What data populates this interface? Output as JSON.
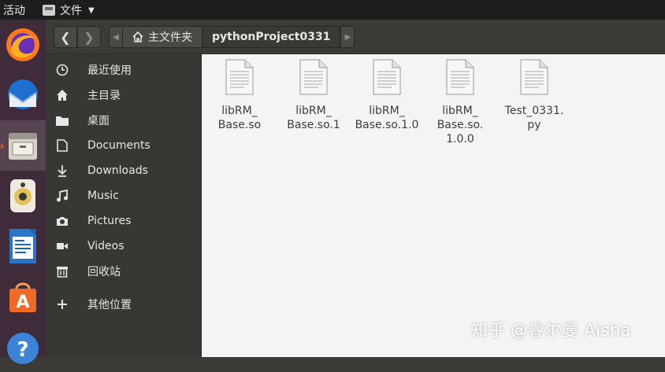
{
  "topbar": {
    "activities": "活动",
    "app_menu_label": "文件",
    "app_menu_icon": "file-manager-icon",
    "caret_icon": "caret-down-icon"
  },
  "dock": {
    "items": [
      {
        "name": "firefox",
        "icon": "firefox-icon"
      },
      {
        "name": "thunderbird",
        "icon": "thunderbird-icon"
      },
      {
        "name": "files",
        "icon": "file-cabinet-icon",
        "active": true
      },
      {
        "name": "rhythmbox",
        "icon": "speaker-icon"
      },
      {
        "name": "libreoffice-writer",
        "icon": "writer-icon"
      },
      {
        "name": "software",
        "icon": "software-bag-icon"
      },
      {
        "name": "help",
        "icon": "help-icon"
      }
    ]
  },
  "header": {
    "back_icon": "chevron-left-icon",
    "forward_icon": "chevron-right-icon",
    "home_icon": "home-icon",
    "breadcrumbs": [
      "主文件夹",
      "pythonProject0331"
    ]
  },
  "sidebar": {
    "items": [
      {
        "label": "最近使用",
        "icon": "recent-clock-icon"
      },
      {
        "label": "主目录",
        "icon": "home-icon"
      },
      {
        "label": "桌面",
        "icon": "folder-icon"
      },
      {
        "label": "Documents",
        "icon": "document-icon"
      },
      {
        "label": "Downloads",
        "icon": "download-arrow-icon"
      },
      {
        "label": "Music",
        "icon": "music-note-icon"
      },
      {
        "label": "Pictures",
        "icon": "camera-icon"
      },
      {
        "label": "Videos",
        "icon": "video-icon"
      },
      {
        "label": "回收站",
        "icon": "trash-icon"
      },
      {
        "label": "其他位置",
        "icon": "plus-icon"
      }
    ]
  },
  "files": [
    {
      "line1": "libRM_",
      "line2": "Base.so",
      "line3": ""
    },
    {
      "line1": "libRM_",
      "line2": "Base.so.1",
      "line3": ""
    },
    {
      "line1": "libRM_",
      "line2": "Base.so.1.0",
      "line3": ""
    },
    {
      "line1": "libRM_",
      "line2": "Base.so.",
      "line3": "1.0.0"
    },
    {
      "line1": "Test_0331.",
      "line2": "py",
      "line3": ""
    }
  ],
  "watermark": "知乎 @睿尔曼 Aisha"
}
